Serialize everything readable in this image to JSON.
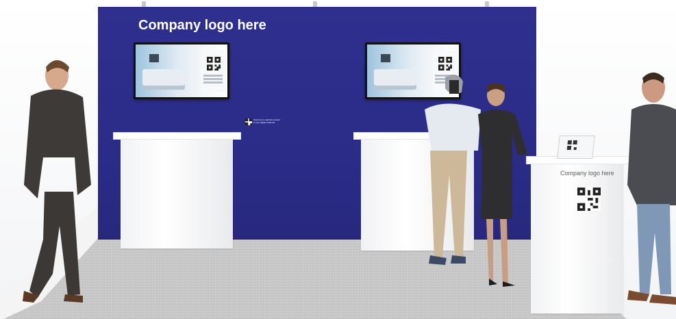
{
  "scene": "exhibition booth rendering",
  "wall": {
    "logo_text": "Company logo here",
    "color": "#2b2c88"
  },
  "wall_qr": {
    "caption": "Scan here to add this content to your digital notebook"
  },
  "kiosk": {
    "logo_text": "Company logo here"
  },
  "colors": {
    "wall": "#2b2c88",
    "floor": "#c9c9c9",
    "counter": "#ffffff"
  }
}
